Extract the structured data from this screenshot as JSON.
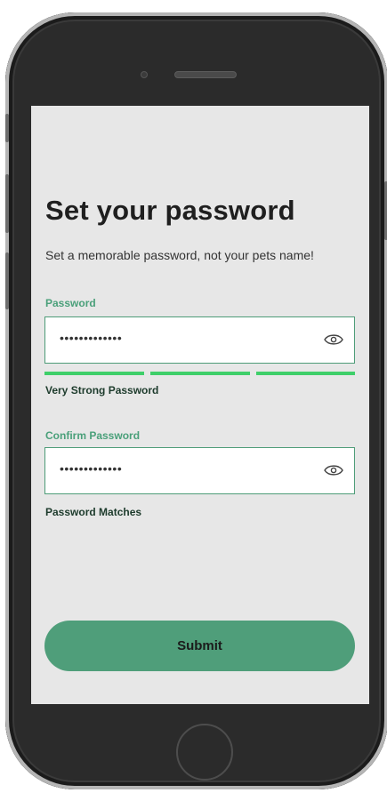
{
  "page": {
    "title": "Set your password",
    "subtitle": "Set a memorable password, not your pets name!"
  },
  "password": {
    "label": "Password",
    "value_masked": "•••••••••••••",
    "strength_text": "Very Strong Password",
    "strength_segments_filled": 3,
    "strength_segments_total": 3
  },
  "confirm": {
    "label": "Confirm Password",
    "value_masked": "•••••••••••••",
    "status_text": "Password Matches"
  },
  "submit": {
    "label": "Submit"
  },
  "icons": {
    "toggle_visibility": "eye-icon"
  },
  "colors": {
    "accent": "#4f9e7a",
    "label_green": "#4aa07a",
    "meter_green": "#3fcf6a",
    "screen_bg": "#e7e7e7"
  }
}
